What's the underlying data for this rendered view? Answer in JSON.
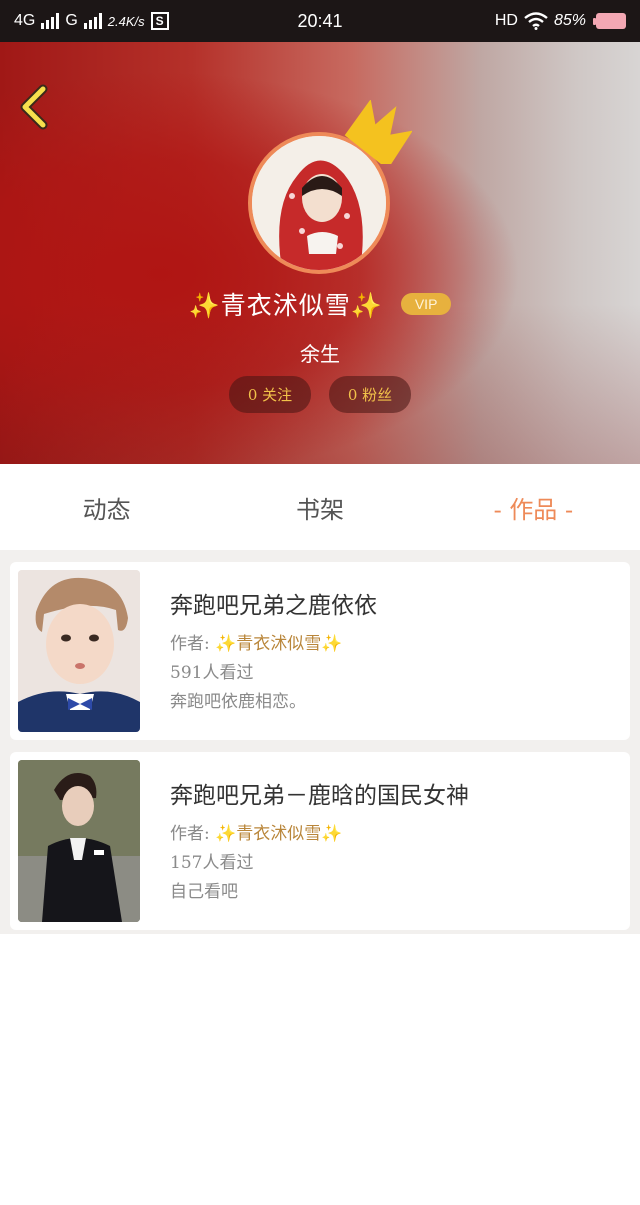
{
  "status_bar": {
    "network1": "4G",
    "network2": "G",
    "speed": "2.4K/s",
    "s_icon": "S",
    "time": "20:41",
    "hd": "HD",
    "battery": "85%"
  },
  "profile": {
    "username": "✨青衣沭似雪✨",
    "vip": "VIP",
    "signature": "余生",
    "following": "0 关注",
    "fans": "0 粉丝"
  },
  "tabs": [
    {
      "label": "动态"
    },
    {
      "label": "书架"
    },
    {
      "label": "作品"
    }
  ],
  "works": [
    {
      "title": "奔跑吧兄弟之鹿依依",
      "author_prefix": "作者:",
      "author": "✨青衣沭似雪✨",
      "reads": "591人看过",
      "desc": "奔跑吧依鹿相恋。"
    },
    {
      "title": "奔跑吧兄弟－鹿晗的国民女神",
      "author_prefix": "作者:",
      "author": "✨青衣沭似雪✨",
      "reads": "157人看过",
      "desc": "自己看吧"
    }
  ],
  "colors": {
    "accent": "#ee8a58",
    "vip": "#e7b13e",
    "stat_text": "#f2c24a"
  }
}
